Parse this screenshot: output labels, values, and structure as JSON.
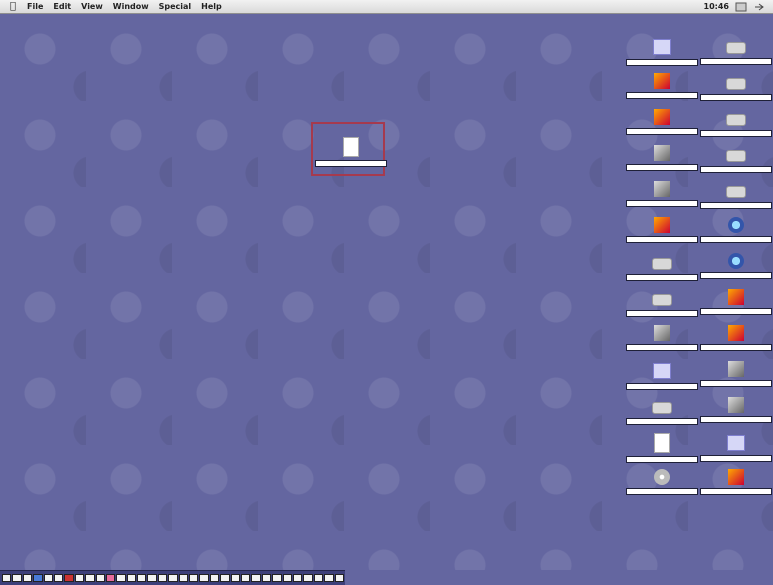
{
  "menubar": {
    "apple": "",
    "items": [
      "File",
      "Edit",
      "View",
      "Window",
      "Special",
      "Help"
    ],
    "clock": "10:46",
    "app_icon": "app-icon"
  },
  "desktop": {
    "background": "#6466a0",
    "selected_item": {
      "label": "",
      "icon": "document-icon"
    },
    "right_column_a": [
      {
        "label": "",
        "icon": "folder-icon"
      },
      {
        "label": "",
        "icon": "app-icon"
      },
      {
        "label": "",
        "icon": "app-icon"
      },
      {
        "label": "",
        "icon": "network-icon"
      },
      {
        "label": "",
        "icon": "network-icon"
      },
      {
        "label": "",
        "icon": "app-icon"
      },
      {
        "label": "",
        "icon": "drive-icon"
      },
      {
        "label": "",
        "icon": "drive-icon"
      },
      {
        "label": "",
        "icon": "network-icon"
      },
      {
        "label": "",
        "icon": "folder-icon"
      },
      {
        "label": "",
        "icon": "drive-icon"
      },
      {
        "label": "",
        "icon": "document-icon"
      },
      {
        "label": "",
        "icon": "cd-icon"
      }
    ],
    "right_column_b": [
      {
        "label": "",
        "icon": "drive-icon"
      },
      {
        "label": "",
        "icon": "drive-icon"
      },
      {
        "label": "",
        "icon": "drive-icon"
      },
      {
        "label": "",
        "icon": "drive-icon"
      },
      {
        "label": "",
        "icon": "drive-icon"
      },
      {
        "label": "",
        "icon": "globe-icon"
      },
      {
        "label": "",
        "icon": "globe-icon"
      },
      {
        "label": "",
        "icon": "app-icon"
      },
      {
        "label": "",
        "icon": "app-icon"
      },
      {
        "label": "",
        "icon": "network-icon"
      },
      {
        "label": "",
        "icon": "network-icon"
      },
      {
        "label": "",
        "icon": "folder-icon"
      },
      {
        "label": "",
        "icon": "app-icon"
      }
    ]
  },
  "taskbar": {
    "buttons": [
      "white",
      "white",
      "white",
      "blue",
      "white",
      "white",
      "red",
      "white",
      "white",
      "white",
      "pink",
      "white",
      "white",
      "white",
      "white",
      "white",
      "white",
      "white",
      "white",
      "white",
      "white",
      "white",
      "white",
      "white",
      "white",
      "white",
      "white",
      "white",
      "white",
      "white",
      "white",
      "white",
      "white"
    ]
  }
}
